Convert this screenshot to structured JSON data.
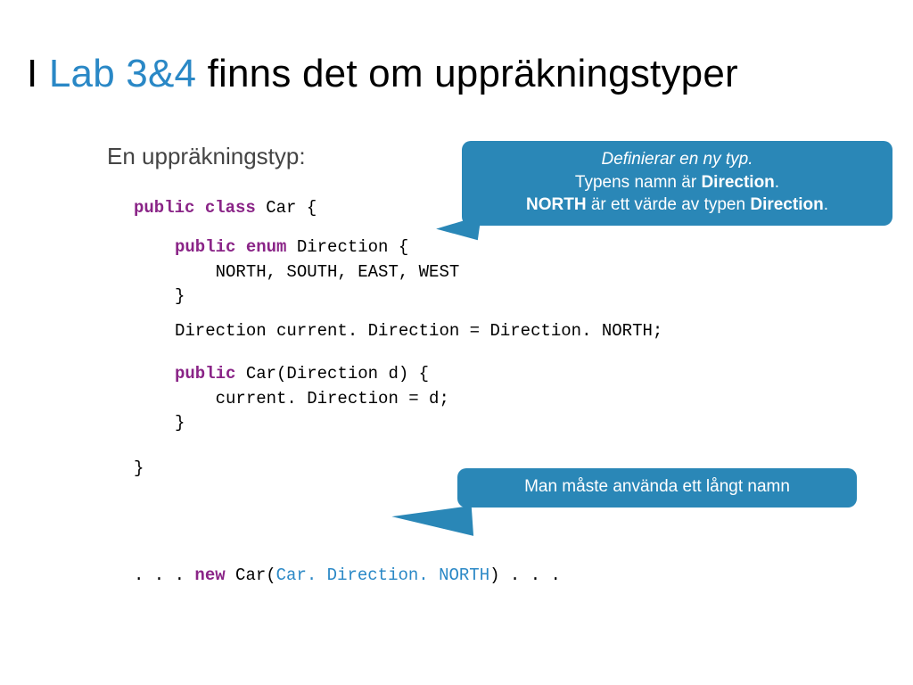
{
  "title": {
    "pre": "I ",
    "lab": "Lab 3&4",
    "mid": " finns det om ",
    "upp": "uppräkningstyper"
  },
  "subtitle": "En uppräkningstyp:",
  "code": {
    "line1_kw1": "public",
    "line1_kw2": "class",
    "line1_rest": " Car {",
    "enum_kw1": "public",
    "enum_kw2": "enum",
    "enum_rest": " Direction {",
    "enum_vals": "    NORTH, SOUTH, EAST, WEST",
    "enum_close": "}",
    "field": "Direction current. Direction = Direction. NORTH;",
    "ctor_kw": "public",
    "ctor_sig": " Car(Direction d) {",
    "ctor_body": "    current. Direction = d;",
    "ctor_close": "}",
    "class_close": "}",
    "usage_pre": ". . . ",
    "usage_kw": "new",
    "usage_mid": " Car(",
    "usage_arg": "Car. Direction. NORTH",
    "usage_post": ") . . ."
  },
  "callout_top": {
    "l1": "Definierar en ny typ.",
    "l2a": "Typens namn är ",
    "l2b": "Direction",
    "l2c": ".",
    "l3a": "NORTH",
    "l3b": " är ett värde av typen ",
    "l3c": "Direction",
    "l3d": "."
  },
  "callout_bottom": {
    "text": "Man måste använda ett långt namn"
  }
}
